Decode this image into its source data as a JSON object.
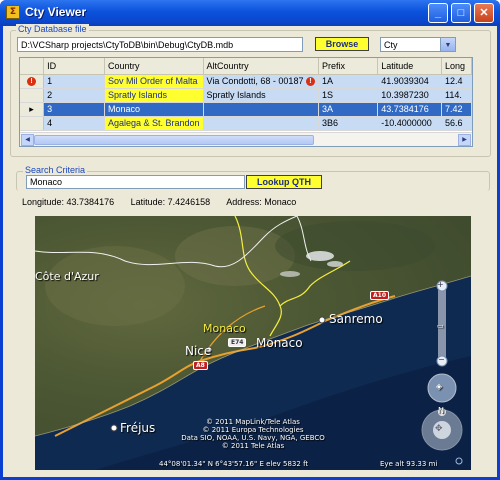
{
  "window": {
    "title": "Cty Viewer",
    "icon": "app-icon",
    "buttons": [
      "minimize",
      "maximize",
      "close"
    ]
  },
  "db_group": {
    "label": "Cty Database file",
    "path": "D:\\VCSharp projects\\CtyToDB\\bin\\Debug\\CtyDB.mdb",
    "browse_label": "Browse",
    "table_selected": "Cty"
  },
  "grid": {
    "columns": [
      "ID",
      "Country",
      "AltCountry",
      "Prefix",
      "Latitude",
      "Long"
    ],
    "rows": [
      {
        "marker": "error",
        "id": "1",
        "country": "Sov Mil Order of Malta",
        "alt": "Via Condotti, 68 - 00187",
        "alt_error": true,
        "prefix": "1A",
        "lat": "41.9039304",
        "lon": "12.4"
      },
      {
        "marker": "",
        "id": "2",
        "country": "Spratly Islands",
        "alt": "Spratly Islands",
        "alt_error": false,
        "prefix": "1S",
        "lat": "10.3987230",
        "lon": "114."
      },
      {
        "marker": "current",
        "id": "3",
        "country": "Monaco",
        "alt": "",
        "alt_error": false,
        "prefix": "3A",
        "lat": "43.7384176",
        "lon": "7.42"
      },
      {
        "marker": "",
        "id": "4",
        "country": "Agalega & St. Brandon",
        "alt": "",
        "alt_error": false,
        "prefix": "3B6",
        "lat": "-10.4000000",
        "lon": "56.6"
      }
    ]
  },
  "search": {
    "label": "Search Criteria",
    "value": "Monaco",
    "button_label": "Lookup QTH"
  },
  "result": {
    "longitude": "Longitude: 43.7384176",
    "latitude": "Latitude: 7.4246158",
    "address": "Address: Monaco"
  },
  "map": {
    "labels": {
      "cote": "Côte d'Azur",
      "monaco_yellow": "Monaco",
      "monaco_white": "Monaco",
      "nice": "Nice",
      "sanremo": "Sanremo",
      "frejus": "Fréjus",
      "e74": "E74",
      "a8": "A8",
      "a10": "A10"
    },
    "copyright": [
      "© 2011 MapLink/Tele Atlas",
      "© 2011 Europa Technologies",
      "Data SIO, NOAA, U.S. Navy, NGA, GEBCO",
      "© 2011 Tele Atlas"
    ],
    "status_coords": "44°08'01.34\" N     6°43'57.16\" E   elev  5832 ft",
    "eye_alt": "Eye alt    93.33 mi"
  }
}
